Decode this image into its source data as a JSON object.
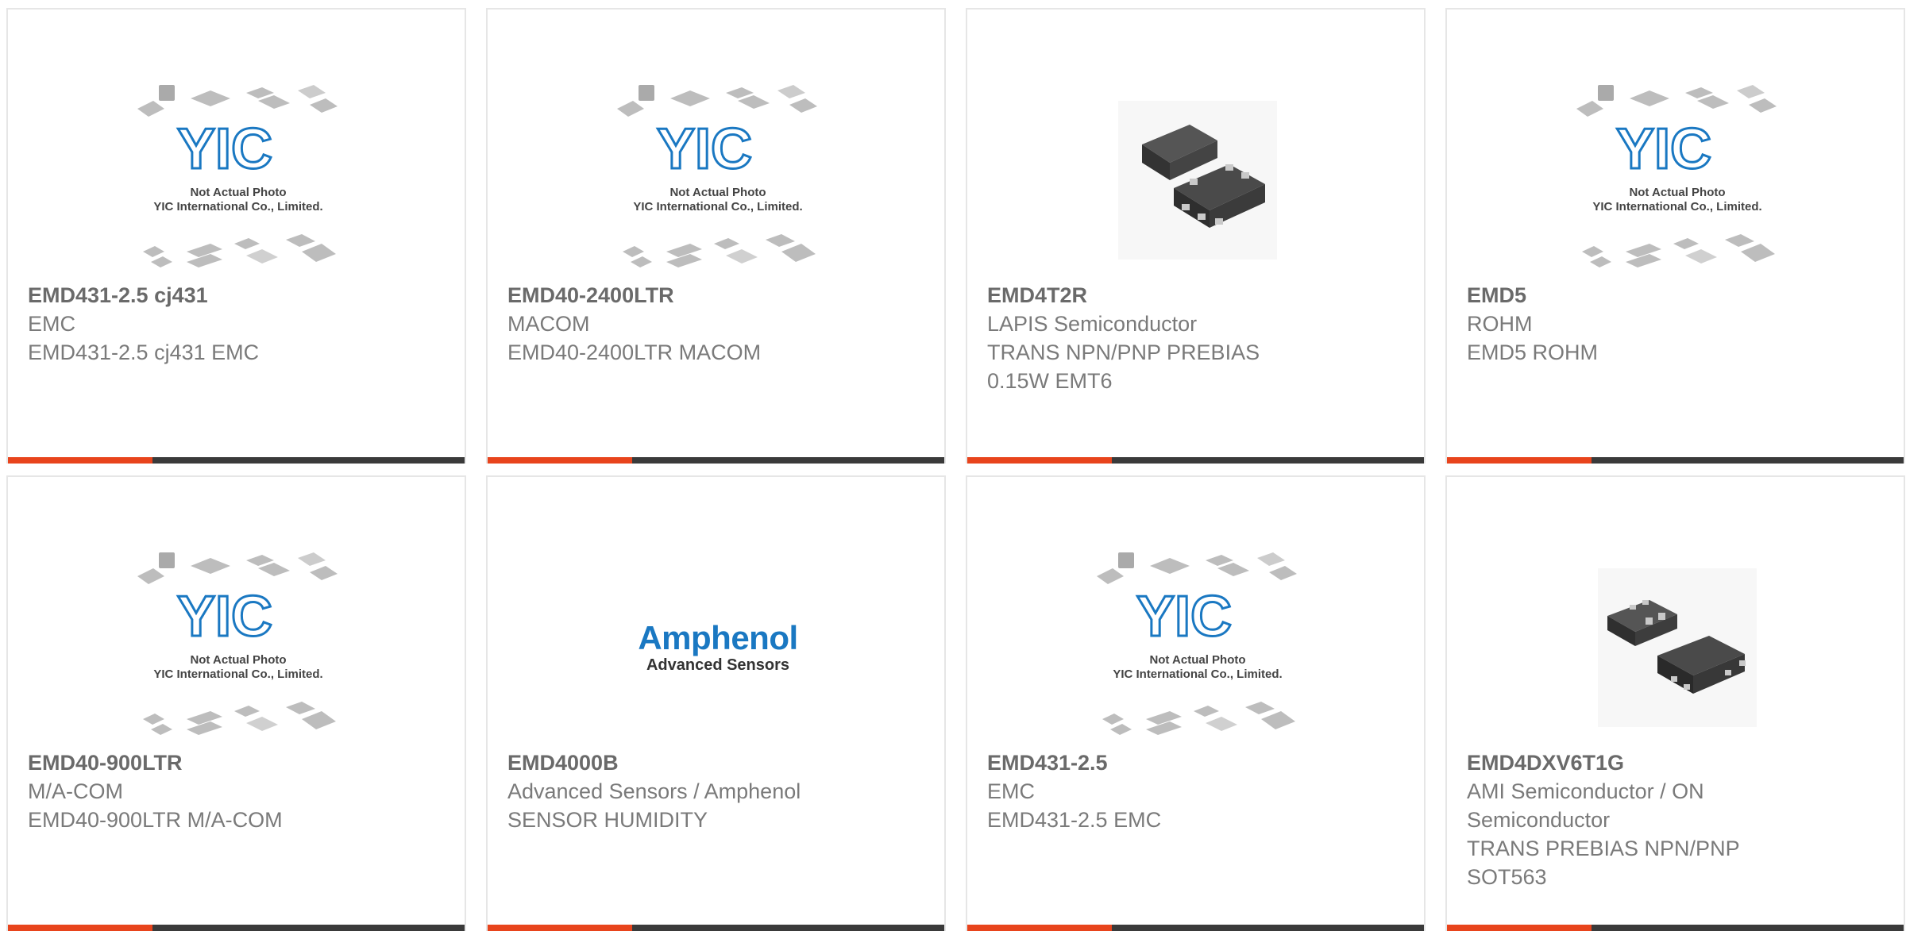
{
  "colors": {
    "accent": "#e8441c",
    "bar": "#3a3a3a",
    "text": "#7a7a7a",
    "yic_blue": "#1a78c2"
  },
  "placeholder": {
    "line1": "Not Actual Photo",
    "line2": "YIC International Co., Limited."
  },
  "amphenol": {
    "brand": "Amphenol",
    "sub": "Advanced Sensors"
  },
  "products": [
    {
      "image": "yic-placeholder",
      "part": "EMD431-2.5 cj431",
      "lines": [
        "EMC",
        "EMD431-2.5 cj431 EMC"
      ]
    },
    {
      "image": "yic-placeholder",
      "part": "EMD40-2400LTR",
      "lines": [
        "MACOM",
        "EMD40-2400LTR MACOM"
      ]
    },
    {
      "image": "chip-emt6",
      "part": "EMD4T2R",
      "lines": [
        "LAPIS Semiconductor",
        "TRANS NPN/PNP PREBIAS",
        "0.15W EMT6"
      ]
    },
    {
      "image": "yic-placeholder",
      "part": "EMD5",
      "lines": [
        "ROHM",
        "EMD5 ROHM"
      ]
    },
    {
      "image": "yic-placeholder",
      "part": "EMD40-900LTR",
      "lines": [
        "M/A-COM",
        "EMD40-900LTR M/A-COM"
      ]
    },
    {
      "image": "amphenol-logo",
      "part": "EMD4000B",
      "lines": [
        "Advanced Sensors / Amphenol",
        "SENSOR HUMIDITY"
      ]
    },
    {
      "image": "yic-placeholder",
      "part": "EMD431-2.5",
      "lines": [
        "EMC",
        "EMD431-2.5 EMC"
      ]
    },
    {
      "image": "chip-sot563",
      "part": "EMD4DXV6T1G",
      "lines": [
        "AMI Semiconductor / ON",
        "Semiconductor",
        "TRANS PREBIAS NPN/PNP",
        "SOT563"
      ]
    }
  ]
}
